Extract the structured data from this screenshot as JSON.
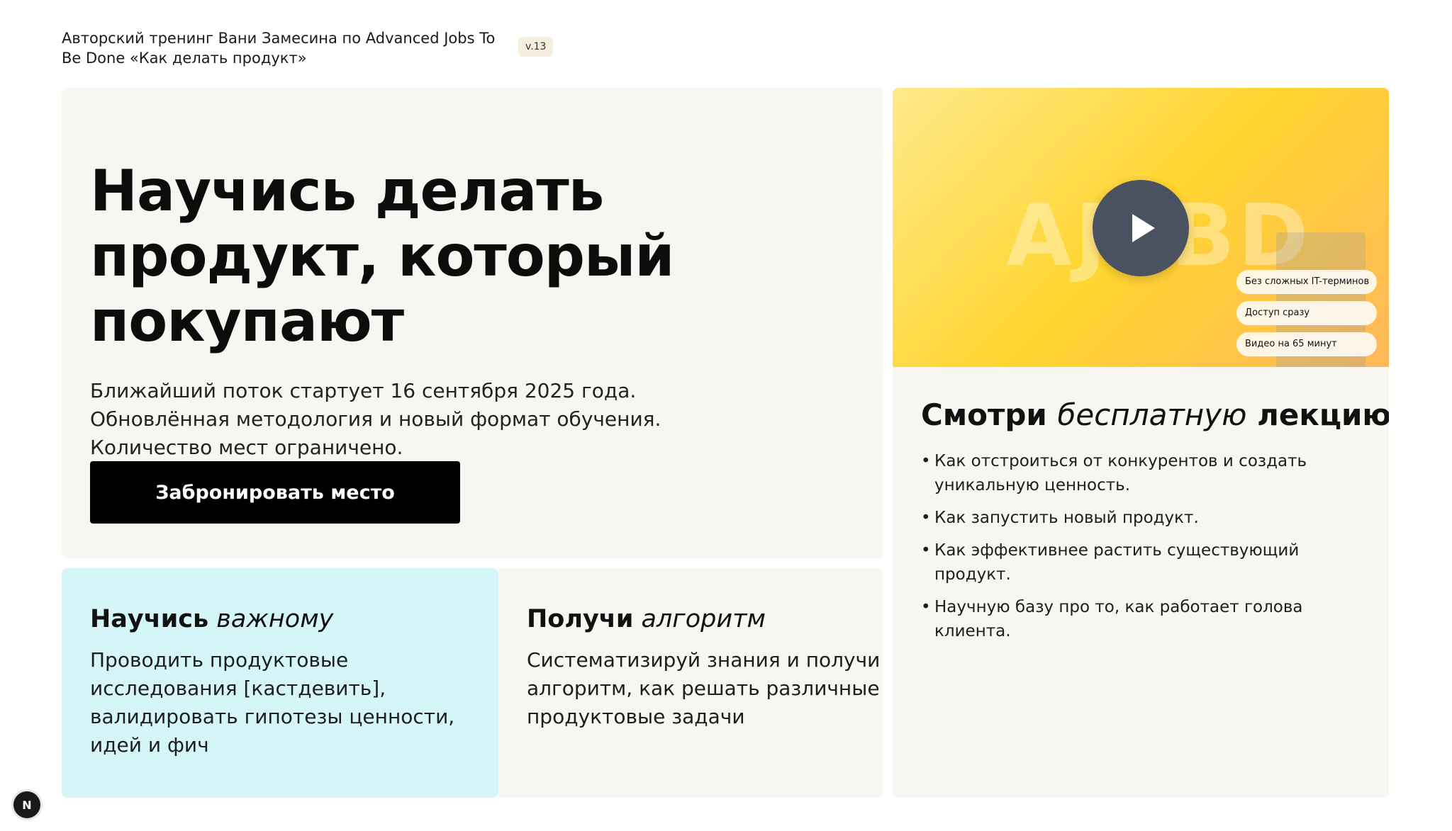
{
  "header": {
    "title": "Авторский тренинг Вани Замесина по Advanced Jobs To Be Done «Как делать продукт»",
    "version": "v.13"
  },
  "hero": {
    "title": "Научись делать продукт, который покупают",
    "lines": [
      "Ближайший поток стартует 16 сентября 2025 года.",
      "Обновлённая методология и новый формат обучения.",
      "Количество мест ограничено."
    ],
    "cta_label": "Забронировать место"
  },
  "features": [
    {
      "title_bold": "Научись",
      "title_italic": "важному",
      "body": "Проводить продуктовые исследования [кастдевить], валидировать гипотезы ценности, идей и фич"
    },
    {
      "title_bold": "Получи",
      "title_italic": "алгоритм",
      "body": "Систематизируй знания и получи алгоритм, как решать различные продуктовые задачи"
    }
  ],
  "lecture": {
    "video": {
      "watermark": "AJTBD",
      "play_icon": "play-icon",
      "pills": [
        "Без сложных IT-терминов",
        "Доступ сразу",
        "Видео на 65 минут"
      ]
    },
    "title_bold_1": "Смотри",
    "title_italic": "бесплатную",
    "title_bold_2": "лекцию",
    "items": [
      "Как отстроиться от конкурентов и создать уникальную ценность.",
      "Как запустить новый продукт.",
      "Как эффективнее растить существующий продукт.",
      "Научную базу про то, как работает голова клиента."
    ]
  },
  "dev_badge": {
    "label": "N",
    "icon": "nextjs-icon"
  },
  "colors": {
    "card_bg": "#f7f6f0",
    "accent_cyan": "#d4f6f9",
    "cta_bg": "#000000",
    "play_bg": "#4a5262",
    "video_gradient_start": "#ffe98a",
    "video_gradient_end": "#ffb85a"
  }
}
